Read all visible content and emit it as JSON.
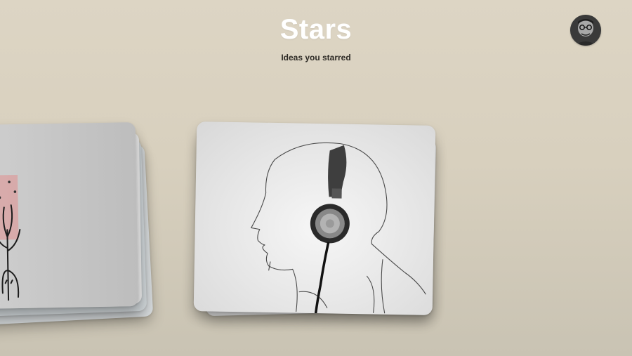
{
  "header": {
    "title": "Stars",
    "subtitle": "Ideas you starred"
  },
  "avatar": {
    "icon": "user-avatar-icon"
  },
  "stacks": [
    {
      "name": "starred-idea-stack-left",
      "thumbnail": "tree-figure-sketch-icon"
    },
    {
      "name": "starred-idea-stack-center",
      "thumbnail": "head-with-headphones-sketch-icon"
    }
  ],
  "colors": {
    "background_top": "#ddd5c4",
    "background_bottom": "#c9c3b3",
    "title": "#ffffff",
    "subtitle": "#2d2a25",
    "card": "#e8e8e8"
  }
}
